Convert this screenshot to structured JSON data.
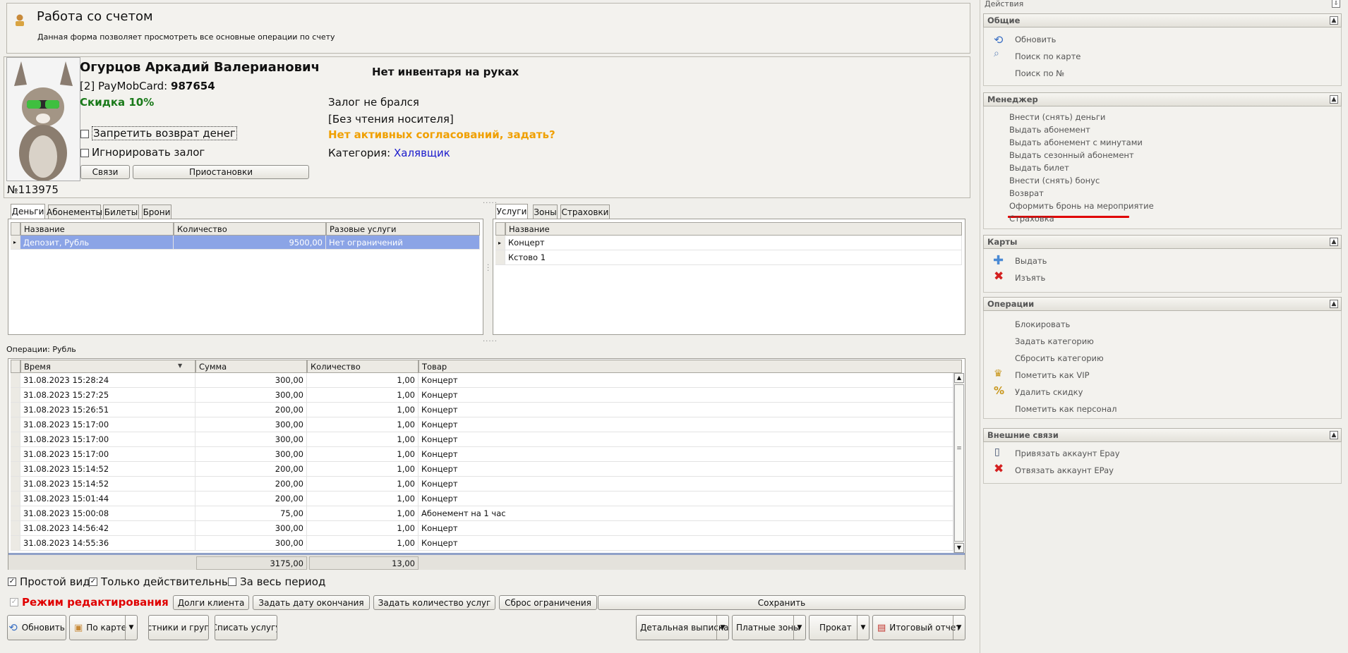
{
  "header": {
    "title": "Работа со счетом",
    "subtitle": "Данная форма позволяет просмотреть все основные  операции по счету"
  },
  "client": {
    "name": "Огурцов Аркадий Валерианович",
    "card_prefix": "[2] PayMobCard:",
    "card_number": "987654",
    "discount": "Скидка 10%",
    "forbid_refund": "Запретить возврат денег",
    "ignore_deposit": "Игнорировать залог",
    "links_button": "Связи",
    "suspend_button": "Приостановки",
    "number": "№113975"
  },
  "status": {
    "inventory": "Нет инвентаря на руках",
    "deposit": "Залог не брался",
    "reader": "[Без чтения носителя]",
    "approvals": "Нет активных согласований, задать?",
    "category_label": "Категория:",
    "category_value": "Халявщик"
  },
  "left_tabs": [
    "Деньги",
    "Абонементы",
    "Билеты",
    "Брони"
  ],
  "money_grid": {
    "columns": [
      "Название",
      "Количество",
      "Разовые услуги"
    ],
    "rows": [
      [
        "Депозит, Рубль",
        "9500,00",
        "Нет ограничений"
      ]
    ]
  },
  "right_tabs": [
    "Услуги",
    "Зоны",
    "Страховки"
  ],
  "services_grid": {
    "columns": [
      "Название"
    ],
    "rows": [
      "Концерт",
      "Кстово 1"
    ]
  },
  "operations": {
    "label": "Операции: Рубль",
    "columns": [
      "Время",
      "Сумма",
      "Количество",
      "Товар"
    ],
    "rows": [
      [
        "31.08.2023 15:28:24",
        "300,00",
        "1,00",
        "Концерт"
      ],
      [
        "31.08.2023 15:27:25",
        "300,00",
        "1,00",
        "Концерт"
      ],
      [
        "31.08.2023 15:26:51",
        "200,00",
        "1,00",
        "Концерт"
      ],
      [
        "31.08.2023 15:17:00",
        "300,00",
        "1,00",
        "Концерт"
      ],
      [
        "31.08.2023 15:17:00",
        "300,00",
        "1,00",
        "Концерт"
      ],
      [
        "31.08.2023 15:17:00",
        "300,00",
        "1,00",
        "Концерт"
      ],
      [
        "31.08.2023 15:14:52",
        "200,00",
        "1,00",
        "Концерт"
      ],
      [
        "31.08.2023 15:14:52",
        "200,00",
        "1,00",
        "Концерт"
      ],
      [
        "31.08.2023 15:01:44",
        "200,00",
        "1,00",
        "Концерт"
      ],
      [
        "31.08.2023 15:00:08",
        "75,00",
        "1,00",
        "Абонемент на 1 час"
      ],
      [
        "31.08.2023 14:56:42",
        "300,00",
        "1,00",
        "Концерт"
      ],
      [
        "31.08.2023 14:55:36",
        "300,00",
        "1,00",
        "Концерт"
      ]
    ],
    "total_sum": "3175,00",
    "total_qty": "13,00"
  },
  "filters": {
    "simple_view": "Простой вид",
    "only_valid": "Только действительные",
    "whole_period": "За весь период"
  },
  "edit_bar": {
    "edit_mode": "Режим редактирования",
    "client_debts": "Долги клиента",
    "set_end_date": "Задать дату окончания",
    "set_service_count": "Задать количество услуг",
    "reset_limit": "Сброс ограничения",
    "save": "Сохранить"
  },
  "bottom_bar": {
    "refresh": "Обновить",
    "by_card": "По карте",
    "participants": "астники и групп",
    "write_off": "Списать услугу",
    "detailed": "Детальная выписка",
    "paid_zones": "Платные зоны",
    "rental": "Прокат",
    "final_report": "Итоговый отчет"
  },
  "actions": {
    "title": "Действия",
    "general": {
      "title": "Общие",
      "items": [
        "Обновить",
        "Поиск по карте",
        "Поиск по №"
      ]
    },
    "manager": {
      "title": "Менеджер",
      "items": [
        "Внести (снять) деньги",
        "Выдать абонемент",
        "Выдать абонемент с минутами",
        "Выдать сезонный абонемент",
        "Выдать билет",
        "Внести (снять) бонус",
        "Возврат",
        "Оформить бронь на мероприятие",
        "Страховка"
      ]
    },
    "cards": {
      "title": "Карты",
      "items": [
        "Выдать",
        "Изъять"
      ]
    },
    "ops": {
      "title": "Операции",
      "items": [
        "Блокировать",
        "Задать категорию",
        "Сбросить категорию",
        "Пометить как VIP",
        "Удалить скидку",
        "Пометить как персонал"
      ]
    },
    "external": {
      "title": "Внешние связи",
      "items": [
        "Привязать аккаунт Epay",
        "Отвязать аккаунт EPay"
      ]
    }
  },
  "colors": {
    "discount": "#1a7a1a",
    "approvals": "#f0a000",
    "category": "#1a1acc",
    "edit_mode": "#e00000",
    "selected_row": "#8ba4e6",
    "underline": "#e00000"
  }
}
